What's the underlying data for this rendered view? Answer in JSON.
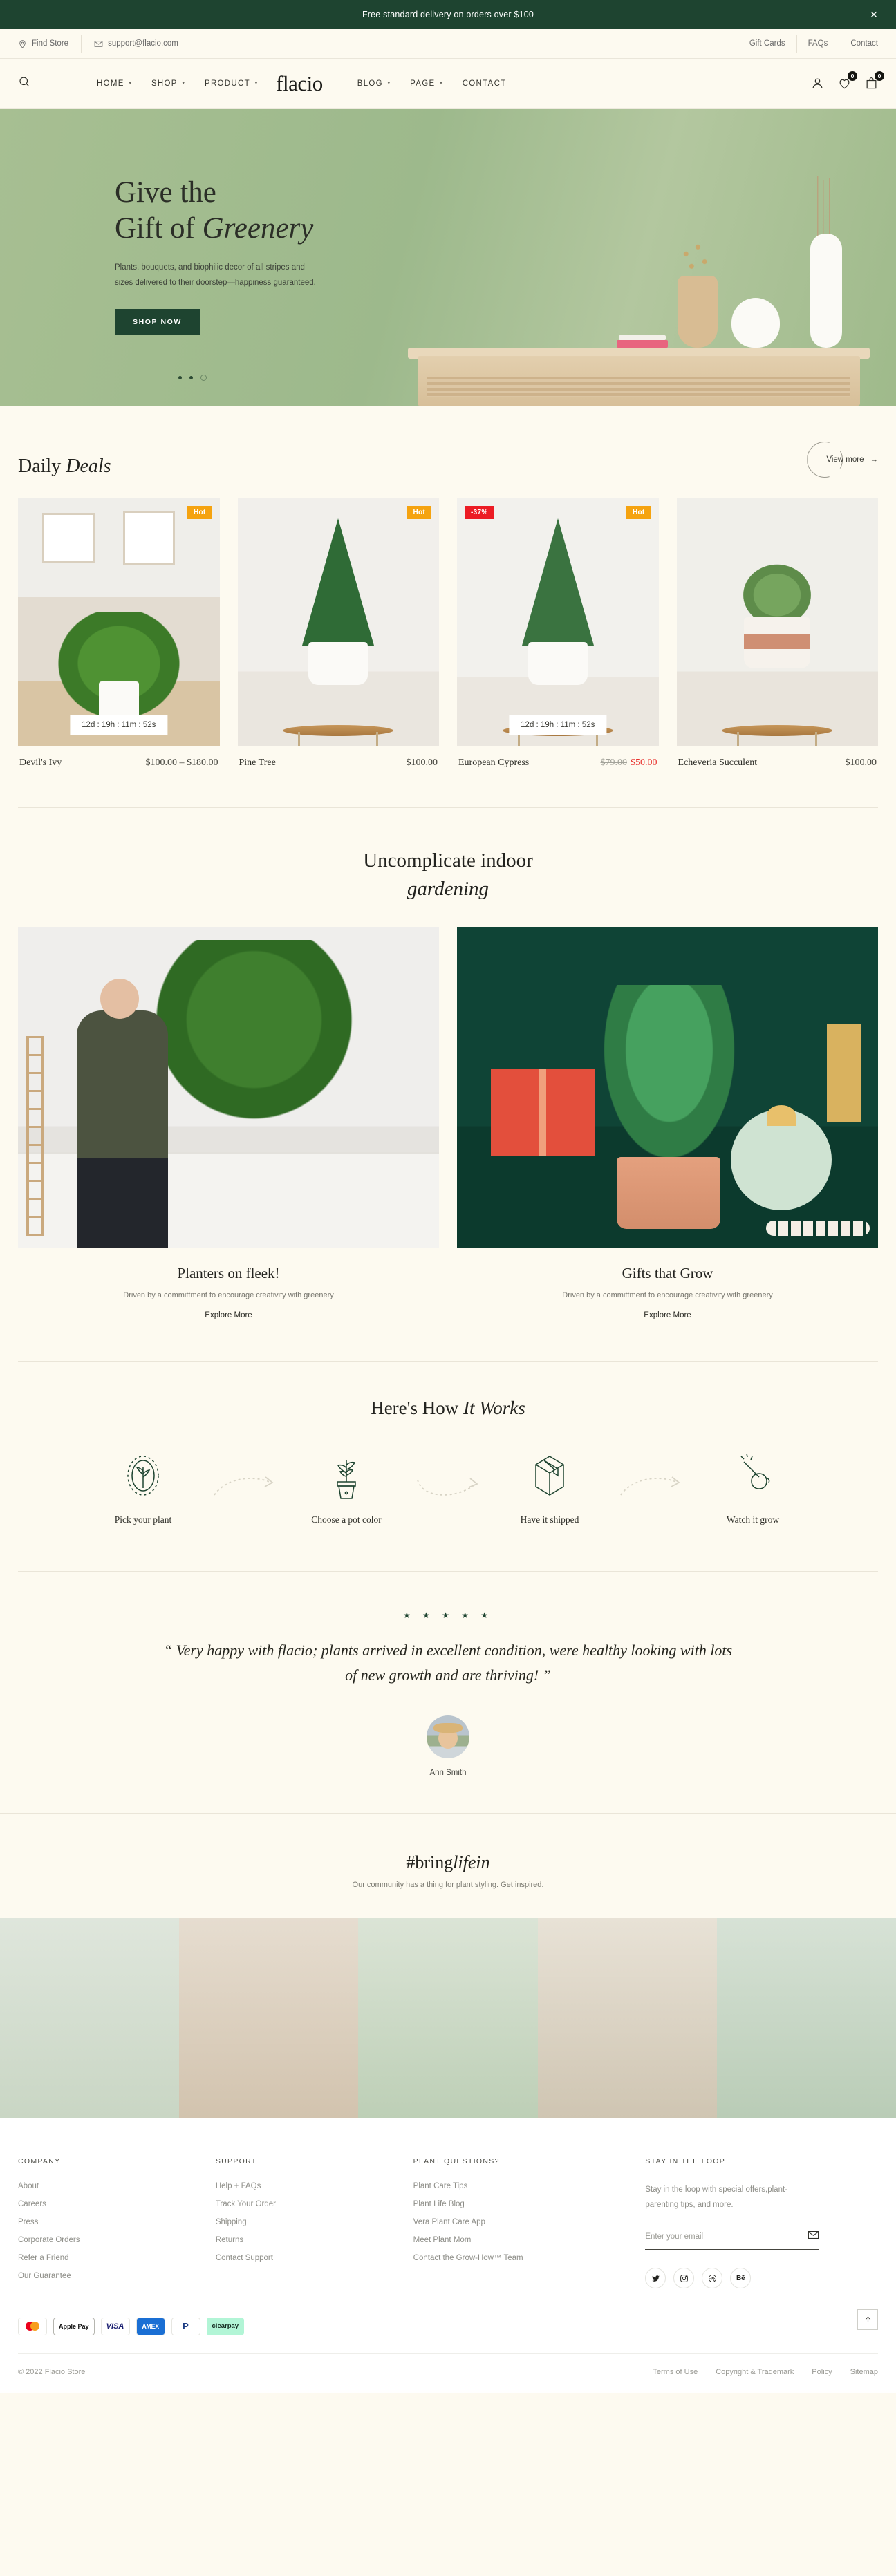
{
  "announcement": {
    "text": "Free standard delivery on orders over $100",
    "close": "✕"
  },
  "utility": {
    "find_store": "Find Store",
    "email": "support@flacio.com",
    "links": [
      "Gift Cards",
      "FAQs",
      "Contact"
    ]
  },
  "nav": {
    "brand": "flacio",
    "left": [
      "HOME",
      "SHOP",
      "PRODUCT"
    ],
    "right": [
      "BLOG",
      "PAGE",
      "CONTACT"
    ],
    "wishlist_count": "0",
    "cart_count": "0"
  },
  "hero": {
    "line1": "Give the",
    "line2a": "Gift of ",
    "line2b": "Greenery",
    "paragraph": "Plants, bouquets, and biophilic decor of all stripes and sizes delivered to their doorstep—happiness guaranteed.",
    "cta": "SHOP NOW"
  },
  "deals": {
    "title_a": "Daily ",
    "title_b": "Deals",
    "view_more": "View more",
    "arrow": "→",
    "products": [
      {
        "name": "Devil's Ivy",
        "price": "$100.00 – $180.00",
        "badge_hot": "Hot",
        "timer": "12d : 19h : 11m : 52s"
      },
      {
        "name": "Pine Tree",
        "price": "$100.00",
        "badge_hot": "Hot",
        "timer": ""
      },
      {
        "name": "European Cypress",
        "old_price": "$79.00",
        "price": "$50.00",
        "badge_hot": "Hot",
        "badge_sale": "-37%",
        "timer": "12d : 19h : 11m : 52s"
      },
      {
        "name": "Echeveria Succulent",
        "price": "$100.00",
        "badge_hot": "",
        "timer": ""
      }
    ]
  },
  "uncomplicate": {
    "title_line1": "Uncomplicate indoor",
    "title_line2": "gardening",
    "cards": [
      {
        "heading": "Planters on fleek!",
        "text": "Driven by a committment to encourage creativity with greenery",
        "cta": "Explore More"
      },
      {
        "heading": "Gifts that Grow",
        "text": "Driven by a committment to encourage creativity with greenery",
        "cta": "Explore More"
      }
    ]
  },
  "how_it_works": {
    "title_a": "Here's How ",
    "title_b": "It Works",
    "steps": [
      {
        "label": "Pick your plant",
        "icon": "leaf-badge-icon"
      },
      {
        "label": "Choose a pot color",
        "icon": "potted-plant-icon"
      },
      {
        "label": "Have it shipped",
        "icon": "shipping-box-icon"
      },
      {
        "label": "Watch it grow",
        "icon": "watering-can-icon"
      }
    ]
  },
  "testimonial": {
    "stars": "★ ★ ★ ★ ★",
    "quote": "“ Very happy with flacio; plants arrived in excellent condition, were healthy looking with lots of new growth and are thriving! ”",
    "author": "Ann Smith"
  },
  "bringlifein": {
    "title_a": "#bring",
    "title_b": "lifein",
    "subtitle": "Our community has a thing for plant styling. Get inspired."
  },
  "footer": {
    "columns": [
      {
        "heading": "COMPANY",
        "links": [
          "About",
          "Careers",
          "Press",
          "Corporate Orders",
          "Refer a Friend",
          "Our Guarantee"
        ]
      },
      {
        "heading": "SUPPORT",
        "links": [
          "Help + FAQs",
          "Track Your Order",
          "Shipping",
          "Returns",
          "Contact Support"
        ]
      },
      {
        "heading": "PLANT QUESTIONS?",
        "links": [
          "Plant Care Tips",
          "Plant Life Blog",
          "Vera Plant Care App",
          "Meet Plant Mom",
          "Contact the Grow-How™ Team"
        ]
      }
    ],
    "newsletter": {
      "heading": "STAY IN THE LOOP",
      "text": "Stay in the loop with special offers,plant-parenting tips, and more.",
      "placeholder": "Enter your email",
      "submit_icon": "envelope-icon"
    },
    "socials": [
      "twitter-icon",
      "instagram-icon",
      "dribbble-icon",
      "behance-icon"
    ],
    "social_labels": [
      "",
      "",
      "",
      "Bē"
    ],
    "payments": [
      "mastercard",
      "Apple Pay",
      "VISA",
      "AMEX",
      "PayPal",
      "clearpay"
    ],
    "copyright": "© 2022 Flacio Store",
    "legal": [
      "Terms of Use",
      "Copyright & Trademark",
      "Policy",
      "Sitemap"
    ],
    "to_top_icon": "arrow-up-icon"
  }
}
